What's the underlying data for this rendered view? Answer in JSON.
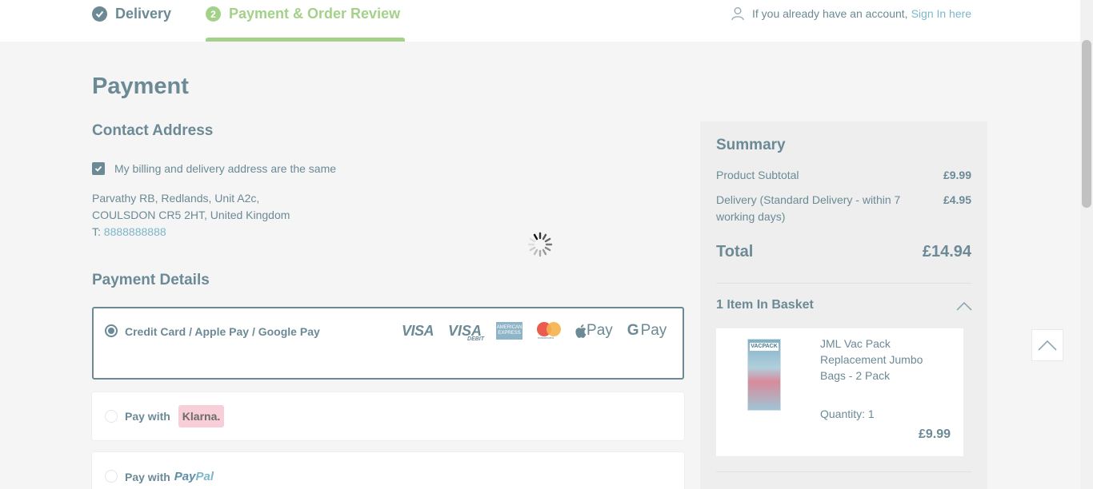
{
  "header": {
    "steps": [
      {
        "label": "Delivery",
        "state": "done"
      },
      {
        "number": "2",
        "label": "Payment & Order Review",
        "state": "active"
      }
    ],
    "account_text": "If you already have an account,",
    "sign_in_link": "Sign In here"
  },
  "page": {
    "title": "Payment",
    "contact_title": "Contact Address",
    "billing_same_label": "My billing and delivery address are the same",
    "billing_same_checked": true,
    "address_line1": "Parvathy RB, Redlands, Unit A2c,",
    "address_line2": "COULSDON CR5 2HT, United Kingdom",
    "phone_prefix": "T:",
    "phone": "8888888888",
    "payment_details_title": "Payment Details"
  },
  "payment_options": {
    "card": {
      "label": "Credit Card / Apple Pay / Google Pay",
      "selected": true
    },
    "card_logos": {
      "visa": "VISA",
      "visa_debit": "VISA",
      "visa_debit_sub": "DEBIT",
      "amex_line1": "AMERICAN",
      "amex_line2": "EXPRESS",
      "mastercard": "mastercard",
      "apple_pay": "Pay",
      "google_pay_g": "G",
      "google_pay": "Pay"
    },
    "klarna": {
      "label": "Pay with",
      "brand": "Klarna."
    },
    "paypal": {
      "label": "Pay with",
      "brand_a": "Pay",
      "brand_b": "Pal"
    }
  },
  "summary": {
    "title": "Summary",
    "subtotal_label": "Product Subtotal",
    "subtotal_value": "£9.99",
    "delivery_label": "Delivery (Standard Delivery - within 7 working days)",
    "delivery_value": "£4.95",
    "total_label": "Total",
    "total_value": "£14.94",
    "basket_title": "1 Item In Basket",
    "item": {
      "image_brand": "VACPACK",
      "name": "JML Vac Pack Replacement Jumbo Bags - 2 Pack",
      "quantity": "Quantity: 1",
      "price": "£9.99"
    }
  },
  "colors": {
    "primary": "#6b8a96",
    "accent_green": "#a3d18a",
    "link": "#7cb7c9",
    "klarna_pink": "#f8cfd8"
  },
  "icons": [
    "check-circle-icon",
    "user-icon",
    "loading-spinner-icon",
    "chevron-up-icon",
    "back-to-top-icon"
  ]
}
